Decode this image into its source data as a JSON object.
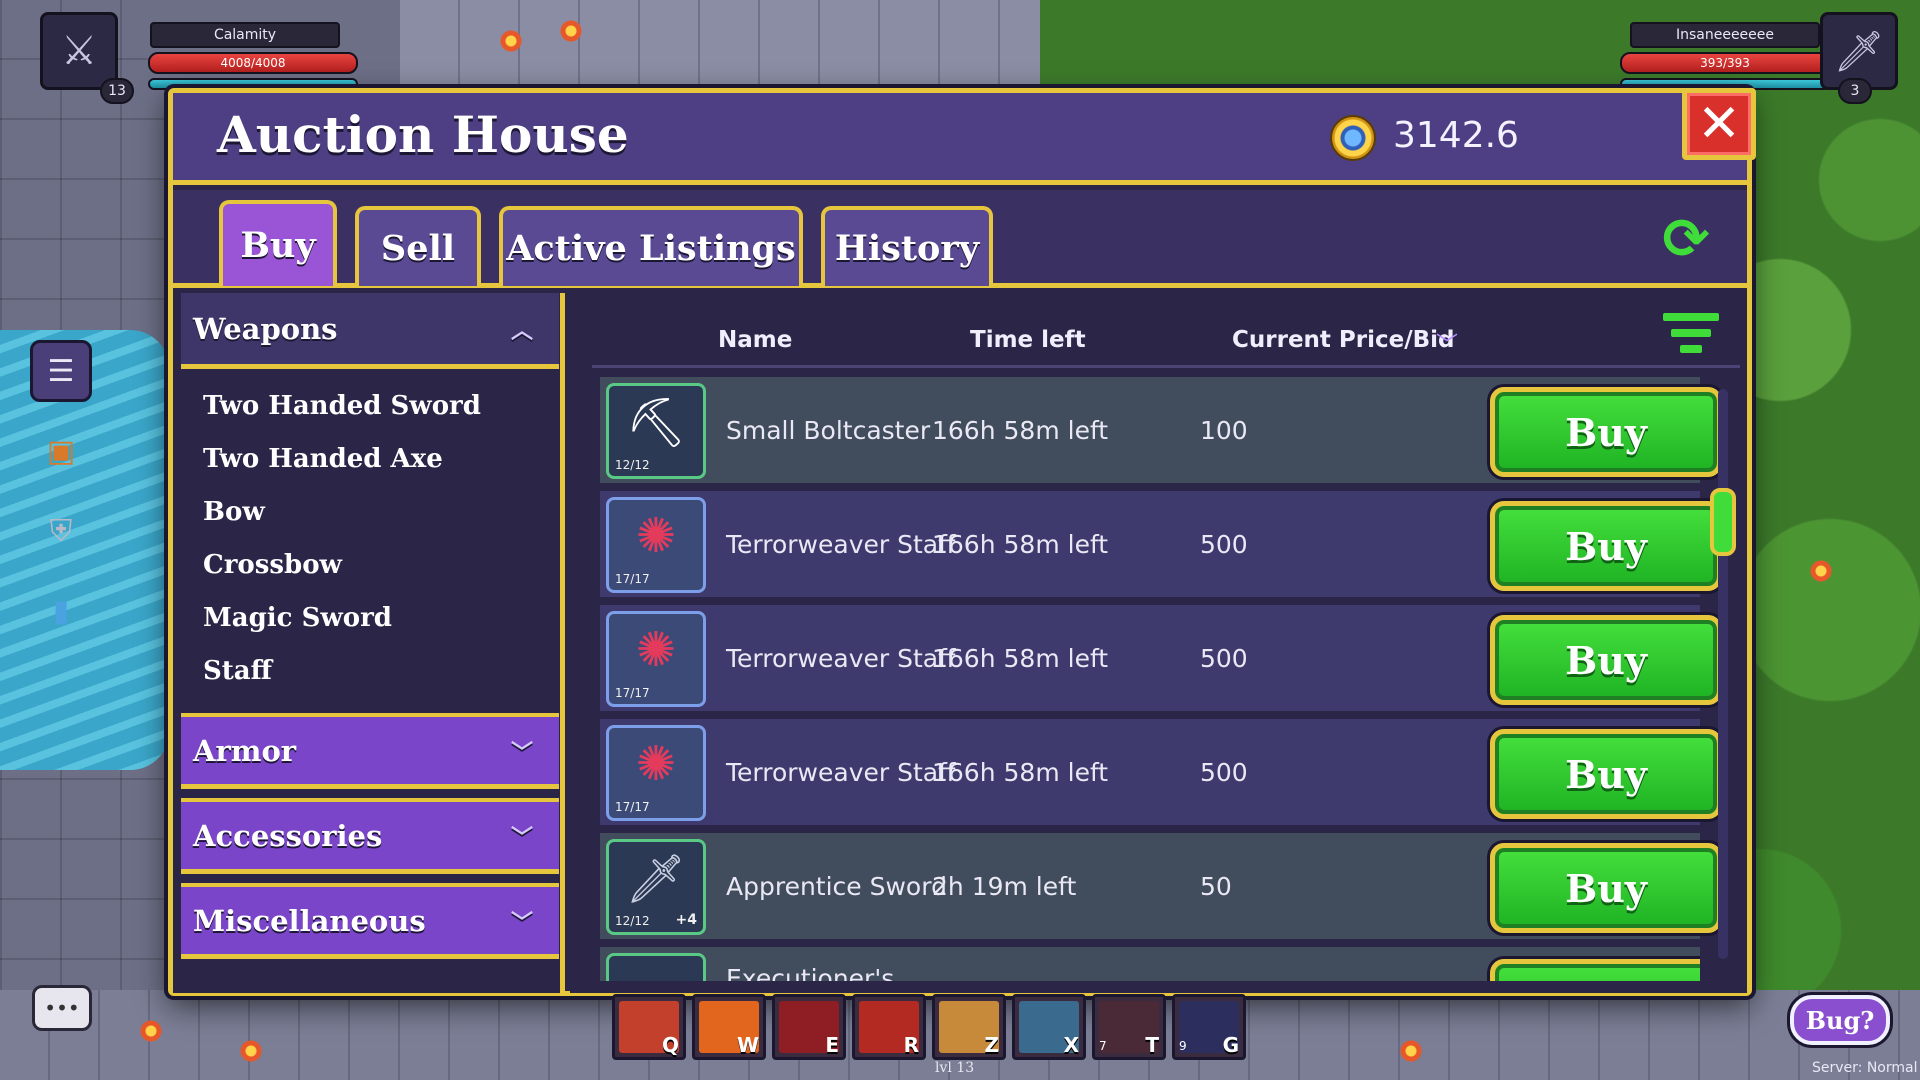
{
  "players": {
    "left": {
      "name": "Calamity",
      "hp": "4008/4008",
      "level": "13"
    },
    "right": {
      "name": "Insaneeeeeee",
      "hp": "393/393",
      "level": "3"
    }
  },
  "auction": {
    "title": "Auction House",
    "gold": "3142.6",
    "close_label": "✕"
  },
  "tabs": [
    {
      "label": "Buy",
      "active": true
    },
    {
      "label": "Sell"
    },
    {
      "label": "Active Listings"
    },
    {
      "label": "History"
    }
  ],
  "categories": {
    "weapons": {
      "label": "Weapons",
      "items": [
        "Two Handed Sword",
        "Two Handed Axe",
        "Bow",
        "Crossbow",
        "Magic Sword",
        "Staff"
      ]
    },
    "armor": {
      "label": "Armor"
    },
    "accessories": {
      "label": "Accessories"
    },
    "misc": {
      "label": "Miscellaneous"
    }
  },
  "table": {
    "columns": {
      "name": "Name",
      "time": "Time left",
      "price": "Current Price/Bid"
    },
    "buy_label": "Buy",
    "rows": [
      {
        "name": "Small Boltcaster",
        "time": "166h 58m left",
        "price": "100",
        "durability": "12/12",
        "icon": "crossbow-icon",
        "plus": ""
      },
      {
        "name": "Terrorweaver Staff",
        "time": "166h 58m left",
        "price": "500",
        "durability": "17/17",
        "icon": "staff-icon",
        "plus": ""
      },
      {
        "name": "Terrorweaver Staff",
        "time": "166h 58m left",
        "price": "500",
        "durability": "17/17",
        "icon": "staff-icon",
        "plus": ""
      },
      {
        "name": "Terrorweaver Staff",
        "time": "166h 58m left",
        "price": "500",
        "durability": "17/17",
        "icon": "staff-icon",
        "plus": ""
      },
      {
        "name": "Apprentice Sword",
        "time": "2h 19m left",
        "price": "50",
        "durability": "12/12",
        "icon": "sword-icon",
        "plus": "+4"
      }
    ],
    "partial_row_name": "Executioner's"
  },
  "hotbar": {
    "slots": [
      {
        "key": "Q",
        "color": "#c2402c"
      },
      {
        "key": "W",
        "color": "#e3661f"
      },
      {
        "key": "E",
        "color": "#8e1d24"
      },
      {
        "key": "R",
        "color": "#b32a22"
      },
      {
        "key": "Z",
        "color": "#c68a3a"
      },
      {
        "key": "X",
        "color": "#3b6a8f"
      },
      {
        "key": "T",
        "count": "7",
        "color": "#4a2a36"
      },
      {
        "key": "G",
        "count": "9",
        "color": "#2c2f5e"
      }
    ],
    "level_label": "lvl 13"
  },
  "footer": {
    "bug_label": "Bug?",
    "server_status": "Server: Normal"
  },
  "colors": {
    "accent_gold": "#e6c63c",
    "panel": "#2b2647",
    "header": "#4e3f84",
    "active_tab": "#9a55d6",
    "buy_green": "#32c92e",
    "close_red": "#d9302b"
  }
}
